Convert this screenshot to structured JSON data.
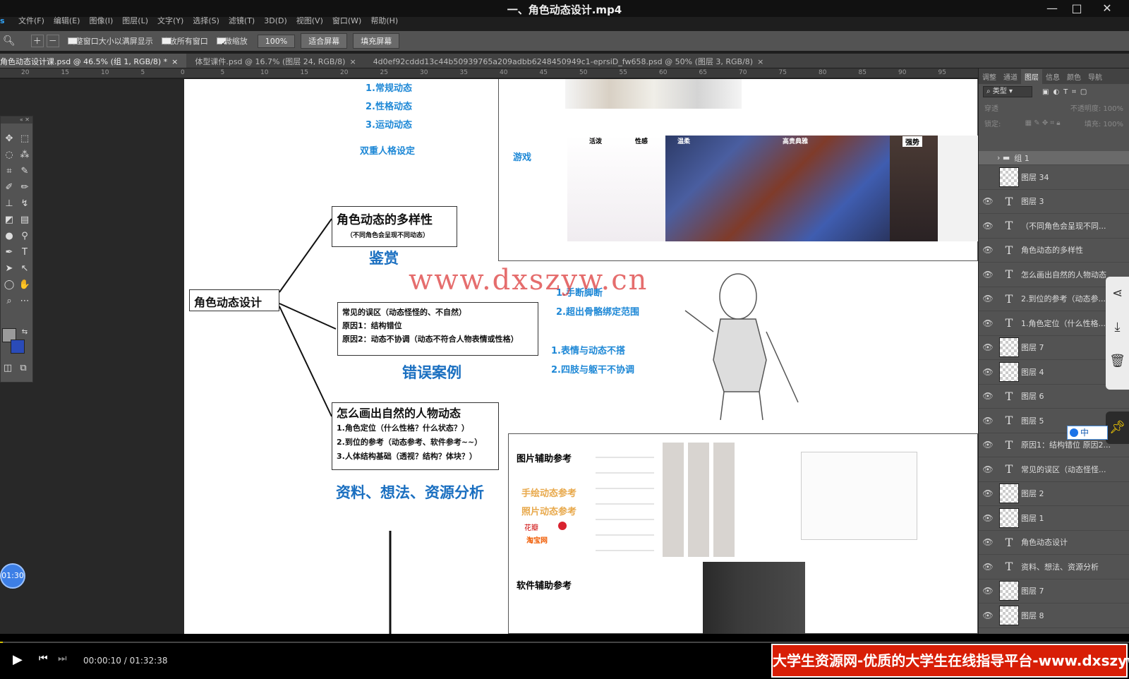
{
  "player": {
    "title": "一、角色动态设计.mp4",
    "current_time": "00:00:10",
    "total_time": "01:32:38",
    "time_display": "00:00:10 / 01:32:38",
    "progress_fraction": 0.0018,
    "timer_badge": "01:30"
  },
  "ps_menu": {
    "logo": "Ps",
    "items": [
      "文件(F)",
      "编辑(E)",
      "图像(I)",
      "图层(L)",
      "文字(Y)",
      "选择(S)",
      "滤镜(T)",
      "3D(D)",
      "视图(V)",
      "窗口(W)",
      "帮助(H)"
    ]
  },
  "options_bar": {
    "resize_windows": "调整窗口大小以满屏显示",
    "zoom_all": "缩放所有窗口",
    "scrubby_zoom": "细微缩放",
    "zoom_value": "100%",
    "fit_screen": "适合屏幕",
    "fill_screen": "填充屏幕"
  },
  "doc_tabs": [
    {
      "label": "角色动态设计课.psd @ 46.5% (组 1, RGB/8) *",
      "active": true
    },
    {
      "label": "体型课件.psd @ 16.7% (图层 24, RGB/8)",
      "active": false
    },
    {
      "label": "4d0ef92cddd13c44b50939765a209adbb6248450949c1-eprsiD_fw658.psd @ 50% (图层 3, RGB/8)",
      "active": false
    }
  ],
  "ruler_ticks": [
    "20",
    "15",
    "10",
    "5",
    "0",
    "5",
    "10",
    "15",
    "20",
    "25",
    "30",
    "35",
    "40",
    "45",
    "50",
    "55",
    "60",
    "65",
    "70",
    "75",
    "80",
    "85",
    "90",
    "95"
  ],
  "panel": {
    "tabs": [
      "调整",
      "通道",
      "图层",
      "信息",
      "颜色",
      "导航"
    ],
    "active_tab": "图层",
    "filter": "类型",
    "blend_mode": "穿透",
    "opacity_label": "不透明度: 100%",
    "lock_label": "锁定:",
    "fill_label": "填充: 100%",
    "layers": [
      {
        "name": "组 1",
        "kind": "group",
        "visible": false
      },
      {
        "name": "图层 34",
        "kind": "pixel",
        "visible": false
      },
      {
        "name": "图层 3",
        "kind": "text",
        "visible": true
      },
      {
        "name": "（不同角色会呈现不同...",
        "kind": "text",
        "visible": true
      },
      {
        "name": "角色动态的多样性",
        "kind": "text",
        "visible": true
      },
      {
        "name": "怎么画出自然的人物动态",
        "kind": "text",
        "visible": true
      },
      {
        "name": "2.到位的参考（动态参...",
        "kind": "text",
        "visible": true
      },
      {
        "name": "1.角色定位（什么性格...",
        "kind": "text",
        "visible": true
      },
      {
        "name": "图层 7",
        "kind": "pixel",
        "visible": true
      },
      {
        "name": "图层 4",
        "kind": "pixel",
        "visible": true
      },
      {
        "name": "图层 6",
        "kind": "text",
        "visible": true
      },
      {
        "name": "图层 5",
        "kind": "text",
        "visible": true
      },
      {
        "name": "原因1：结构错位 原因2...",
        "kind": "text",
        "visible": true
      },
      {
        "name": "常见的误区（动态怪怪...",
        "kind": "text",
        "visible": true
      },
      {
        "name": "图层 2",
        "kind": "pixel",
        "visible": true
      },
      {
        "name": "图层 1",
        "kind": "pixel",
        "visible": true
      },
      {
        "name": "角色动态设计",
        "kind": "text",
        "visible": true
      },
      {
        "name": "资料、想法、资源分析",
        "kind": "text",
        "visible": true
      },
      {
        "name": "图层 7",
        "kind": "pixel",
        "visible": true
      },
      {
        "name": "图层 8",
        "kind": "pixel",
        "visible": true
      }
    ]
  },
  "ime": {
    "label": "中"
  },
  "canvas": {
    "root_node": "角色动态设计",
    "top_list": [
      "1.常规动态",
      "2.性格动态",
      "3.运动动态"
    ],
    "dual_personality": "双重人格设定",
    "diversity_title": "角色动态的多样性",
    "diversity_sub": "（不同角色会呈现不同动态）",
    "appreciation": "鉴赏",
    "game_label": "游戏",
    "game_tags": [
      "活泼",
      "性感",
      "温柔",
      "高贵典雅",
      "强势"
    ],
    "mistakes_lines": [
      "常见的误区（动态怪怪的、不自然）",
      "原因1：结构错位",
      "原因2：动态不协调（动态不符合人物表情或性格）"
    ],
    "mistakes_label": "错误案例",
    "error_points_a": [
      "1.手断脚断",
      "2.超出骨骼绑定范围"
    ],
    "error_points_b": [
      "1.表情与动态不搭",
      "2.四肢与躯干不协调"
    ],
    "natural_title": "怎么画出自然的人物动态",
    "natural_lines": [
      "1.角色定位（什么性格？什么状态？）",
      "2.到位的参考（动态参考、软件参考~~）",
      "3.人体结构基础（透视？结构？体块？）"
    ],
    "resources_label": "资料、想法、资源分析",
    "image_ref_title": "图片辅助参考",
    "hand_ref": "手绘动态参考",
    "photo_ref": "照片动态参考",
    "huaban": "花瓣",
    "taobao": "淘宝网",
    "software_ref_title": "软件辅助参考"
  },
  "watermark": {
    "center": "www.dxszyw.cn",
    "banner": "大学生资源网-优质的大学生在线指导平台-www.dxszyw.cn"
  },
  "colors": {
    "accent_blue": "#1e88d6",
    "banner_red": "#d81e06",
    "ps_blue": "#31a8ff"
  }
}
